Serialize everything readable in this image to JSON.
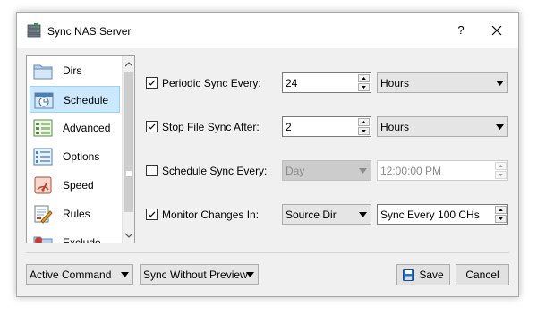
{
  "window": {
    "title": "Sync NAS Server",
    "help_label": "?"
  },
  "sidebar": {
    "items": [
      {
        "label": "Dirs",
        "icon": "folder-icon"
      },
      {
        "label": "Schedule",
        "icon": "schedule-icon"
      },
      {
        "label": "Advanced",
        "icon": "advanced-icon"
      },
      {
        "label": "Options",
        "icon": "options-icon"
      },
      {
        "label": "Speed",
        "icon": "speed-icon"
      },
      {
        "label": "Rules",
        "icon": "rules-icon"
      },
      {
        "label": "Exclude",
        "icon": "exclude-icon"
      }
    ],
    "selected": "Schedule"
  },
  "schedule": {
    "periodic": {
      "label": "Periodic Sync Every:",
      "checked": true,
      "value": "24",
      "unit": "Hours"
    },
    "stop": {
      "label": "Stop File Sync After:",
      "checked": true,
      "value": "2",
      "unit": "Hours"
    },
    "schedule_sync": {
      "label": "Schedule Sync Every:",
      "checked": false,
      "period": "Day",
      "time": "12:00:00 PM"
    },
    "monitor": {
      "label": "Monitor Changes In:",
      "checked": true,
      "source": "Source Dir",
      "threshold": "Sync Every 100 CHs"
    }
  },
  "footer": {
    "command_combo": "Active Command",
    "mode_combo": "Sync Without Preview",
    "save_label": "Save",
    "cancel_label": "Cancel"
  },
  "colors": {
    "selection_bg": "#cce8ff",
    "selection_border": "#99d1ff",
    "dialog_bg": "#f0f0f0"
  }
}
